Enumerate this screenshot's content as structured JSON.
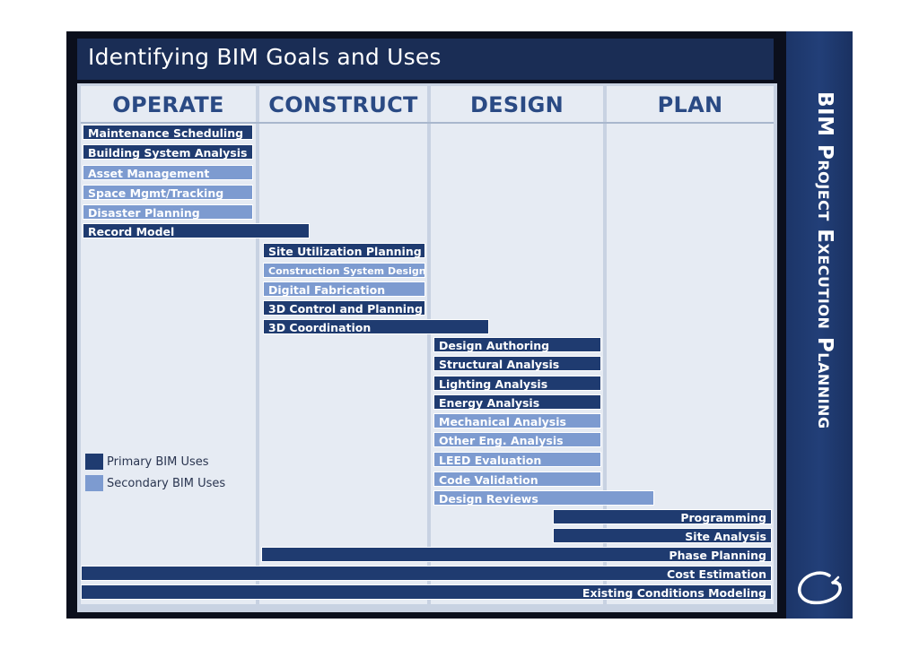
{
  "title": "Identifying BIM Goals and Uses",
  "side_title": "BIM Project Execution Planning",
  "logo": {
    "icon": "university-logo-icon"
  },
  "columns": [
    "OPERATE",
    "CONSTRUCT",
    "DESIGN",
    "PLAN"
  ],
  "colors": {
    "primary": "#1f3b70",
    "secondary": "#7d9bd0",
    "header_text": "#2a4a84"
  },
  "legend": {
    "primary": "Primary BIM Uses",
    "secondary": "Secondary BIM Uses"
  },
  "uses": [
    {
      "label": "Maintenance Scheduling",
      "type": "primary"
    },
    {
      "label": "Building System Analysis",
      "type": "primary"
    },
    {
      "label": "Asset Management",
      "type": "secondary"
    },
    {
      "label": "Space Mgmt/Tracking",
      "type": "secondary"
    },
    {
      "label": "Disaster Planning",
      "type": "secondary"
    },
    {
      "label": "Record Model",
      "type": "primary"
    },
    {
      "label": "Site Utilization Planning",
      "type": "primary"
    },
    {
      "label": "Construction System Design",
      "type": "secondary"
    },
    {
      "label": "Digital Fabrication",
      "type": "secondary"
    },
    {
      "label": "3D Control and Planning",
      "type": "primary"
    },
    {
      "label": "3D Coordination",
      "type": "primary"
    },
    {
      "label": "Design Authoring",
      "type": "primary"
    },
    {
      "label": "Structural Analysis",
      "type": "primary"
    },
    {
      "label": "Lighting Analysis",
      "type": "primary"
    },
    {
      "label": "Energy Analysis",
      "type": "primary"
    },
    {
      "label": "Mechanical Analysis",
      "type": "secondary"
    },
    {
      "label": "Other Eng. Analysis",
      "type": "secondary"
    },
    {
      "label": "LEED Evaluation",
      "type": "secondary"
    },
    {
      "label": "Code Validation",
      "type": "secondary"
    },
    {
      "label": "Design Reviews",
      "type": "secondary"
    },
    {
      "label": "Programming",
      "type": "primary"
    },
    {
      "label": "Site Analysis",
      "type": "primary"
    },
    {
      "label": "Phase Planning",
      "type": "primary"
    },
    {
      "label": "Cost Estimation",
      "type": "primary"
    },
    {
      "label": "Existing Conditions Modeling",
      "type": "primary"
    }
  ]
}
